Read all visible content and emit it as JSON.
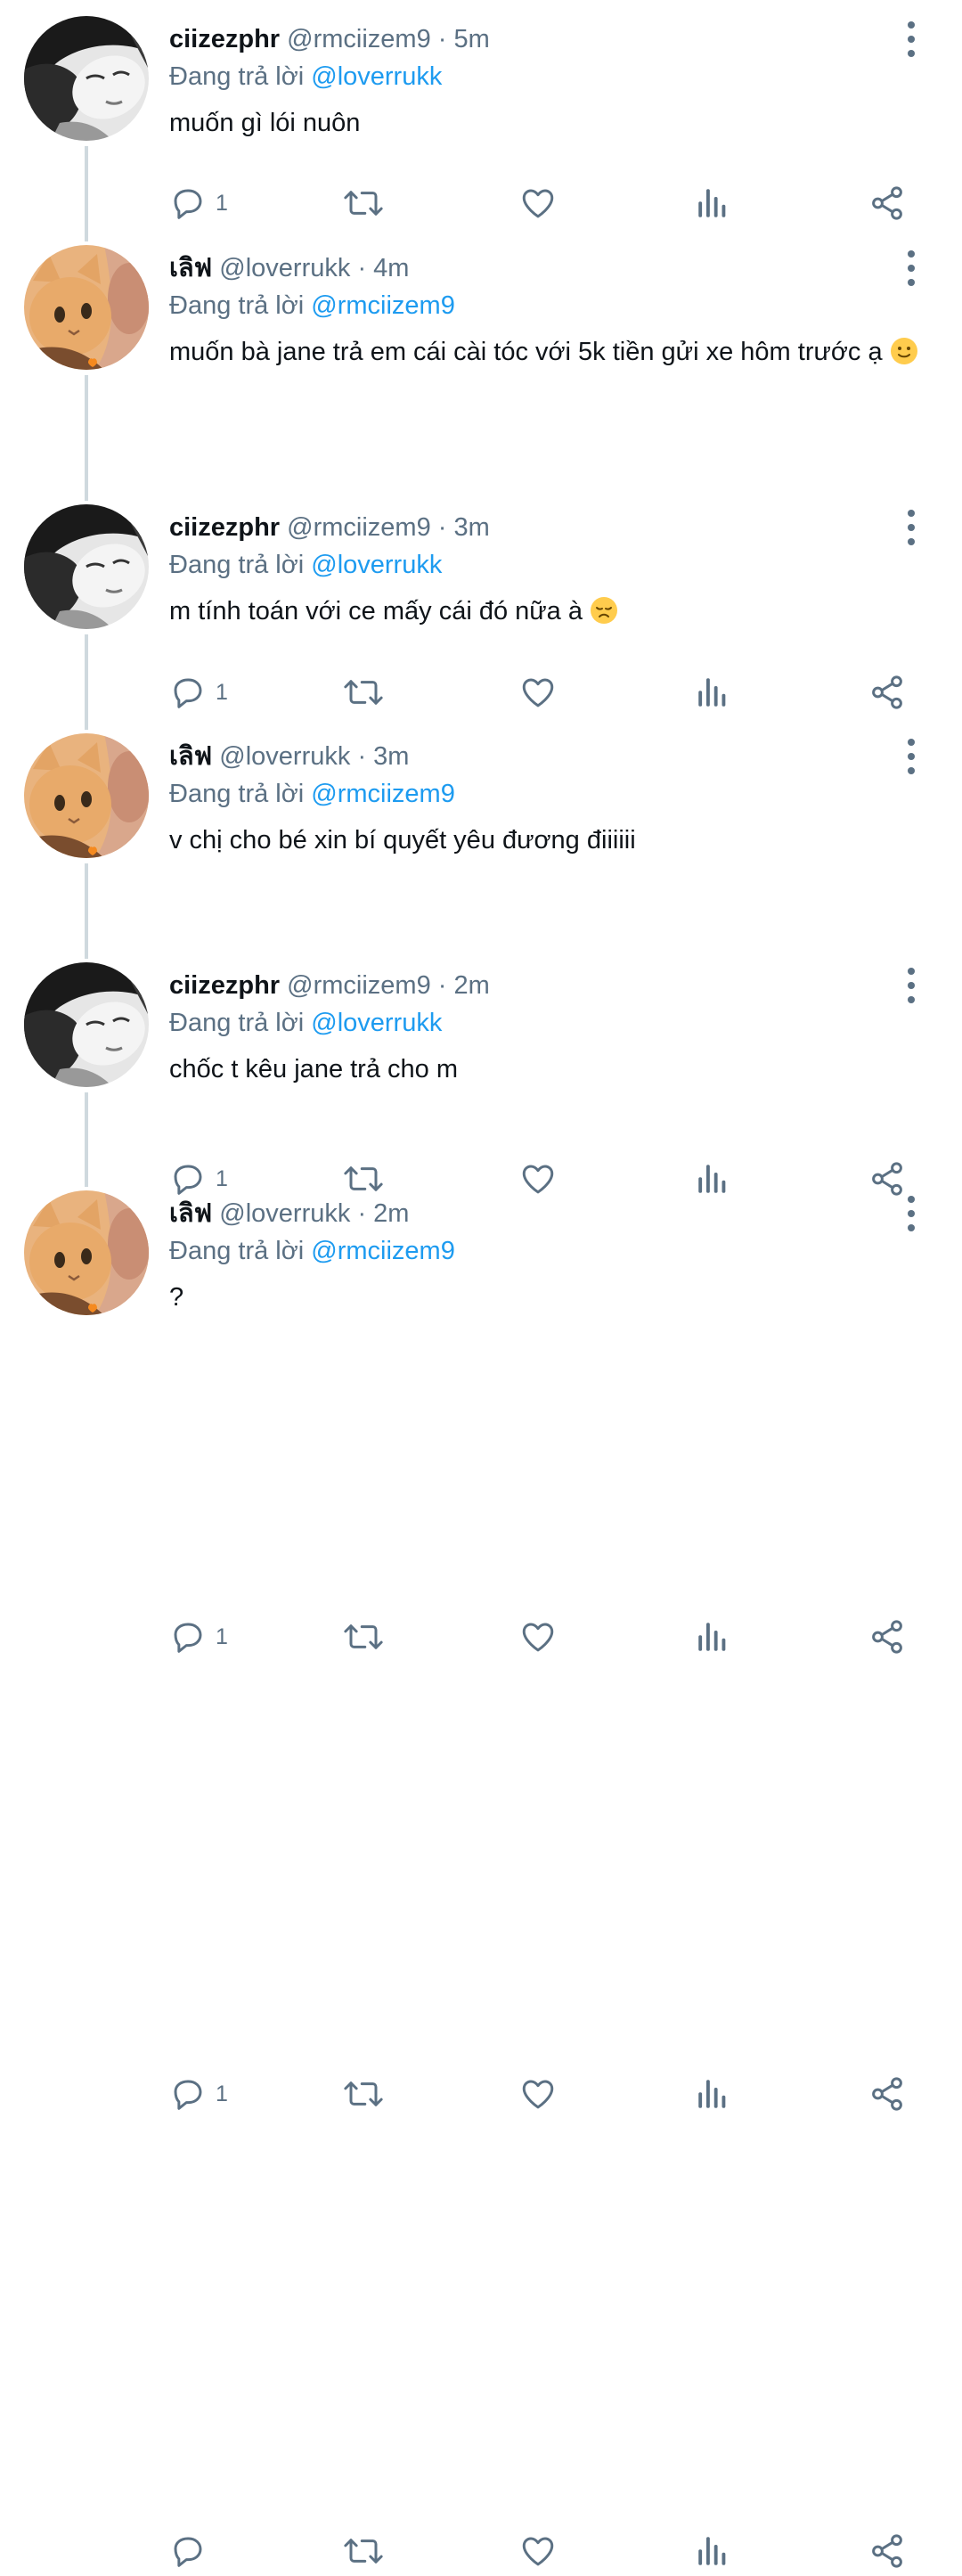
{
  "thread": [
    {
      "author": "ciizezphr",
      "handle": "@rmciizem9",
      "dot": "·",
      "time": "5m",
      "reply_label": "Đang trả lời",
      "reply_to": "@loverrukk",
      "text": "muốn gì lói nuôn",
      "emoji": "",
      "reply_count": "1",
      "avatar": "bw-portrait"
    },
    {
      "author": "เลิฟ",
      "handle": "@loverrukk",
      "dot": "·",
      "time": "4m",
      "reply_label": "Đang trả lời",
      "reply_to": "@rmciizem9",
      "text": "muốn bà jane trả em cái cài tóc với 5k tiền gửi xe hôm trước ạ",
      "emoji": "slightly-smiling-face",
      "reply_count": "1",
      "avatar": "orange-cat"
    },
    {
      "author": "ciizezphr",
      "handle": "@rmciizem9",
      "dot": "·",
      "time": "3m",
      "reply_label": "Đang trả lời",
      "reply_to": "@loverrukk",
      "text": "m tính toán với ce mấy cái đó nữa à",
      "emoji": "disappointed-face",
      "reply_count": "1",
      "avatar": "bw-portrait"
    },
    {
      "author": "เลิฟ",
      "handle": "@loverrukk",
      "dot": "·",
      "time": "3m",
      "reply_label": "Đang trả lời",
      "reply_to": "@rmciizem9",
      "text": "v chị cho bé xin bí quyết yêu đương điiiiii",
      "emoji": "",
      "reply_count": "1",
      "avatar": "orange-cat"
    },
    {
      "author": "ciizezphr",
      "handle": "@rmciizem9",
      "dot": "·",
      "time": "2m",
      "reply_label": "Đang trả lời",
      "reply_to": "@loverrukk",
      "text": "chốc t kêu jane trả cho m",
      "emoji": "",
      "reply_count": "1",
      "avatar": "bw-portrait"
    },
    {
      "author": "เลิฟ",
      "handle": "@loverrukk",
      "dot": "·",
      "time": "2m",
      "reply_label": "Đang trả lời",
      "reply_to": "@rmciizem9",
      "text": "?",
      "emoji": "",
      "reply_count": "",
      "avatar": "orange-cat"
    }
  ],
  "icons": {
    "reply": "reply-icon",
    "retweet": "retweet-icon",
    "like": "heart-icon",
    "stats": "analytics-icon",
    "share": "share-icon",
    "more": "more-vertical-icon"
  },
  "colors": {
    "text": "#0f1419",
    "secondary": "#5b7083",
    "mention": "#1d9bf0",
    "thread_line": "#cfd9de"
  }
}
